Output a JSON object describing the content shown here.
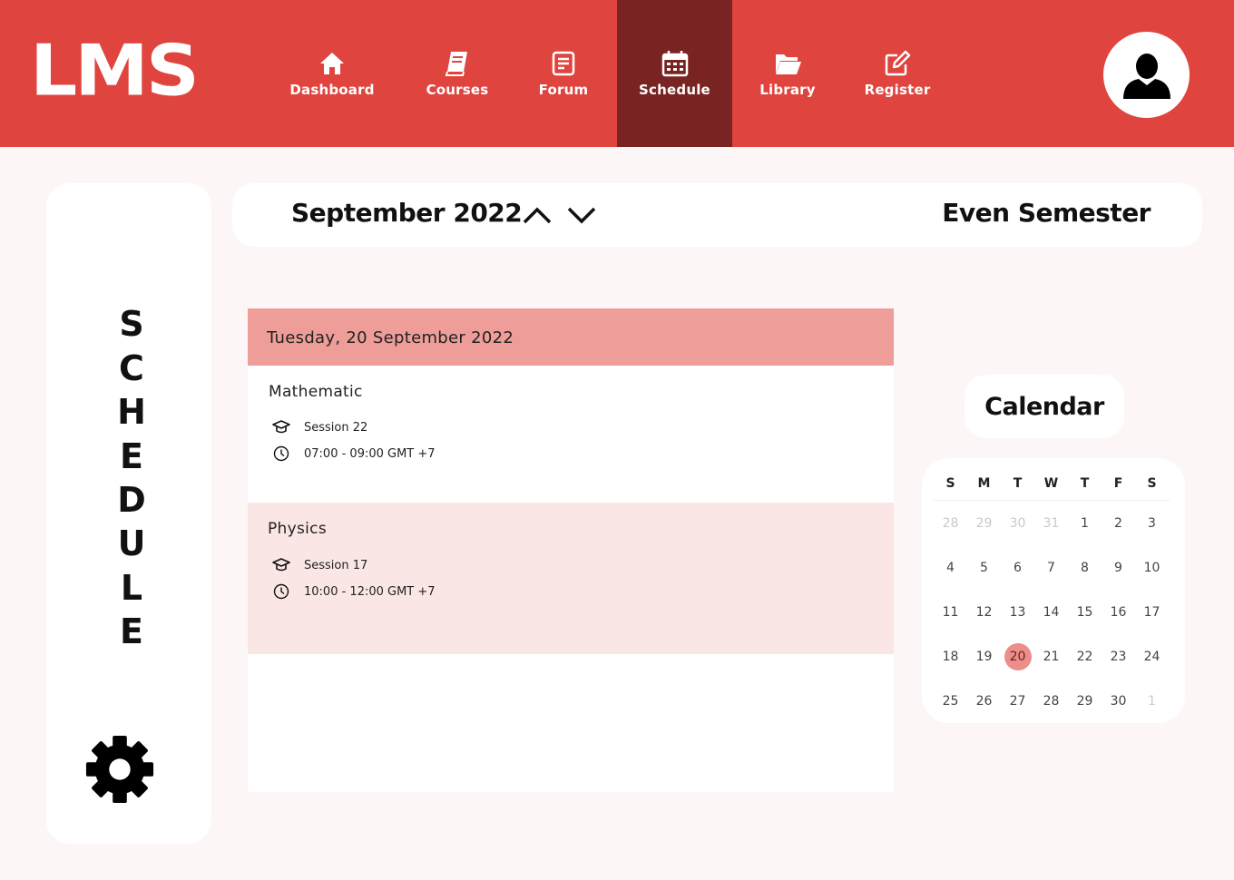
{
  "app": {
    "logo": "LMS"
  },
  "nav": {
    "items": [
      {
        "label": "Dashboard",
        "icon": "home-icon"
      },
      {
        "label": "Courses",
        "icon": "book-icon"
      },
      {
        "label": "Forum",
        "icon": "forum-icon"
      },
      {
        "label": "Schedule",
        "icon": "calendar-icon",
        "active": true
      },
      {
        "label": "Library",
        "icon": "folder-icon"
      },
      {
        "label": "Register",
        "icon": "edit-icon"
      }
    ]
  },
  "profile": {
    "icon": "user-icon"
  },
  "sidebar": {
    "title_letters": [
      "S",
      "C",
      "H",
      "E",
      "D",
      "U",
      "L",
      "E"
    ],
    "settings_icon": "gear-icon"
  },
  "header": {
    "month": "September 2022",
    "semester": "Even Semester",
    "prev_icon": "chevron-up-icon",
    "next_icon": "chevron-down-icon"
  },
  "schedule": {
    "date": "Tuesday, 20 September 2022",
    "sessions": [
      {
        "course": "Mathematic",
        "session": "Session 22",
        "time": "07:00 - 09:00 GMT +7"
      },
      {
        "course": "Physics",
        "session": "Session 17",
        "time": "10:00 - 12:00 GMT +7"
      }
    ]
  },
  "calendar": {
    "title": "Calendar",
    "weekdays": [
      "S",
      "M",
      "T",
      "W",
      "T",
      "F",
      "S"
    ],
    "weeks": [
      [
        "28",
        "29",
        "30",
        "31",
        "1",
        "2",
        "3"
      ],
      [
        "4",
        "5",
        "6",
        "7",
        "8",
        "9",
        "10"
      ],
      [
        "11",
        "12",
        "13",
        "14",
        "15",
        "16",
        "17"
      ],
      [
        "18",
        "19",
        "20",
        "21",
        "22",
        "23",
        "24"
      ],
      [
        "25",
        "26",
        "27",
        "28",
        "29",
        "30",
        "1"
      ]
    ],
    "selected": "20"
  },
  "colors": {
    "primary": "#e0443e",
    "active_nav": "#7a2323",
    "date_header": "#ee9d98",
    "alt_card": "#fbe6e6",
    "selected_day": "#ec8e89"
  }
}
